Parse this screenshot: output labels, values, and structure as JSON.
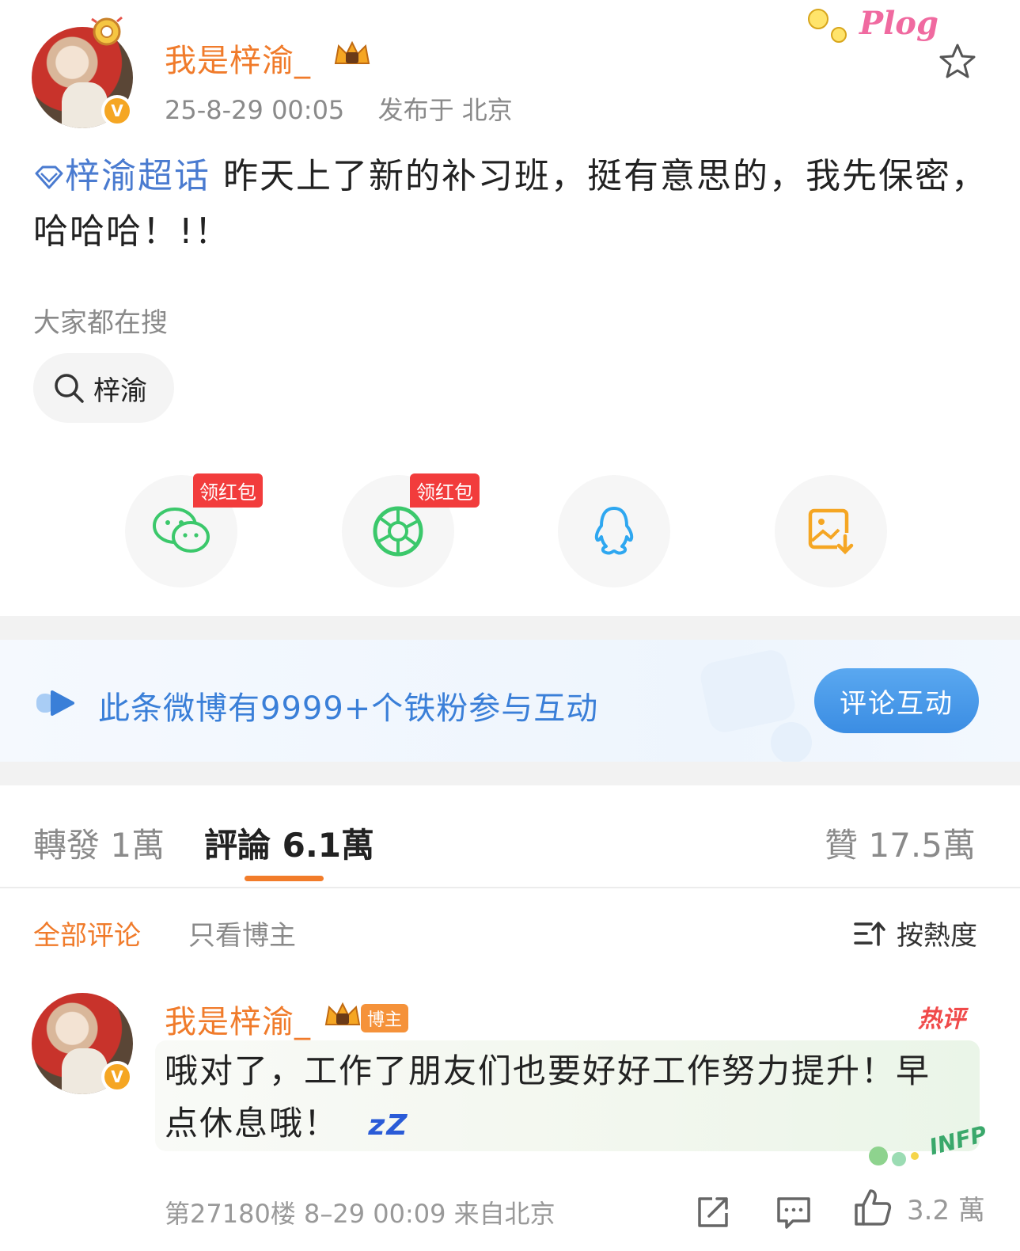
{
  "post": {
    "author": "我是梓渝_",
    "timestamp": "25-8-29 00:05",
    "location": "发布于 北京",
    "sticker_text": "Plog",
    "topic": "梓渝超话",
    "text_rest": " 昨天上了新的补习班，挺有意思的，我先保密，哈哈哈！!！",
    "search_section_label": "大家都在搜",
    "search_chip": "梓渝"
  },
  "share": {
    "buttons": [
      {
        "icon": "wechat-icon",
        "tag": "领红包"
      },
      {
        "icon": "moments-icon",
        "tag": "领红包"
      },
      {
        "icon": "qq-icon",
        "tag": ""
      },
      {
        "icon": "save-image-icon",
        "tag": ""
      }
    ]
  },
  "fan_banner": {
    "text": "此条微博有9999+个铁粉参与互动",
    "button": "评论互动"
  },
  "tabs": {
    "repost": "轉發 1萬",
    "comment": "評論 6.1萬",
    "like": "贊 17.5萬"
  },
  "filters": {
    "all": "全部评论",
    "author_only": "只看博主",
    "sort": "按熱度"
  },
  "comment": {
    "author": "我是梓渝_",
    "badge": "博主",
    "hot": "热评",
    "text": "哦对了，工作了朋友们也要好好工作努力提升！早点休息哦！",
    "zzz": "zZ",
    "sticker": "INFP",
    "floor": "第27180楼 8–29 00:09 来自北京",
    "likes": "3.2 萬"
  },
  "colors": {
    "brand_orange": "#f07b2b",
    "link_blue": "#4a7bd0",
    "banner_blue": "#3a7fd8",
    "red_tag": "#f23c3c"
  }
}
